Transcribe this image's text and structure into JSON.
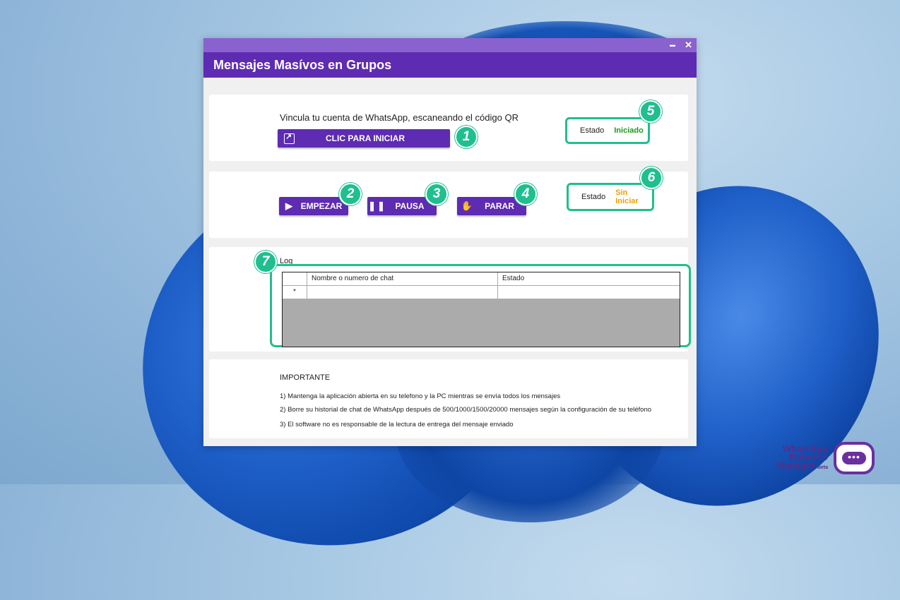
{
  "window": {
    "title": "Mensajes Masívos en Grupos",
    "min_glyph": "▬",
    "close_glyph": "✕",
    "accent": "#5e2bb3"
  },
  "connect": {
    "instruction": "Vincula tu cuenta de WhatsApp, escaneando el código QR",
    "start_label": "CLIC PARA INICIAR",
    "status_key": "Estado",
    "status_value": "Iniciado"
  },
  "controls": {
    "start_label": "EMPEZAR",
    "pause_label": "PAUSA",
    "stop_label": "PARAR",
    "status_key": "Estado",
    "status_value": "Sin Iniciar"
  },
  "log": {
    "label": "Log",
    "columns": [
      "",
      "Nombre o numero de chat",
      "Estado"
    ],
    "new_row_marker": "*"
  },
  "important": {
    "title": "IMPORTANTE",
    "items": [
      "1) Mantenga la aplicación abierta en su telefono y la PC mientras se envía todos los mensajes",
      "2) Borre su historial de chat de WhatsApp después de 500/1000/1500/20000 mensajes según la configuración de su teléfono",
      "3) El software no es responsable de la lectura de entrega del mensaje enviado"
    ]
  },
  "badges": [
    "1",
    "2",
    "3",
    "4",
    "5",
    "6",
    "7"
  ],
  "logo": {
    "line1": "WhatsApp",
    "line2": "Robot+®",
    "line3": "Manager",
    "tag": "Beta"
  },
  "colors": {
    "badge": "#1fbf8f",
    "status_started": "#1a9a1a",
    "status_not_started": "#f0a000"
  }
}
